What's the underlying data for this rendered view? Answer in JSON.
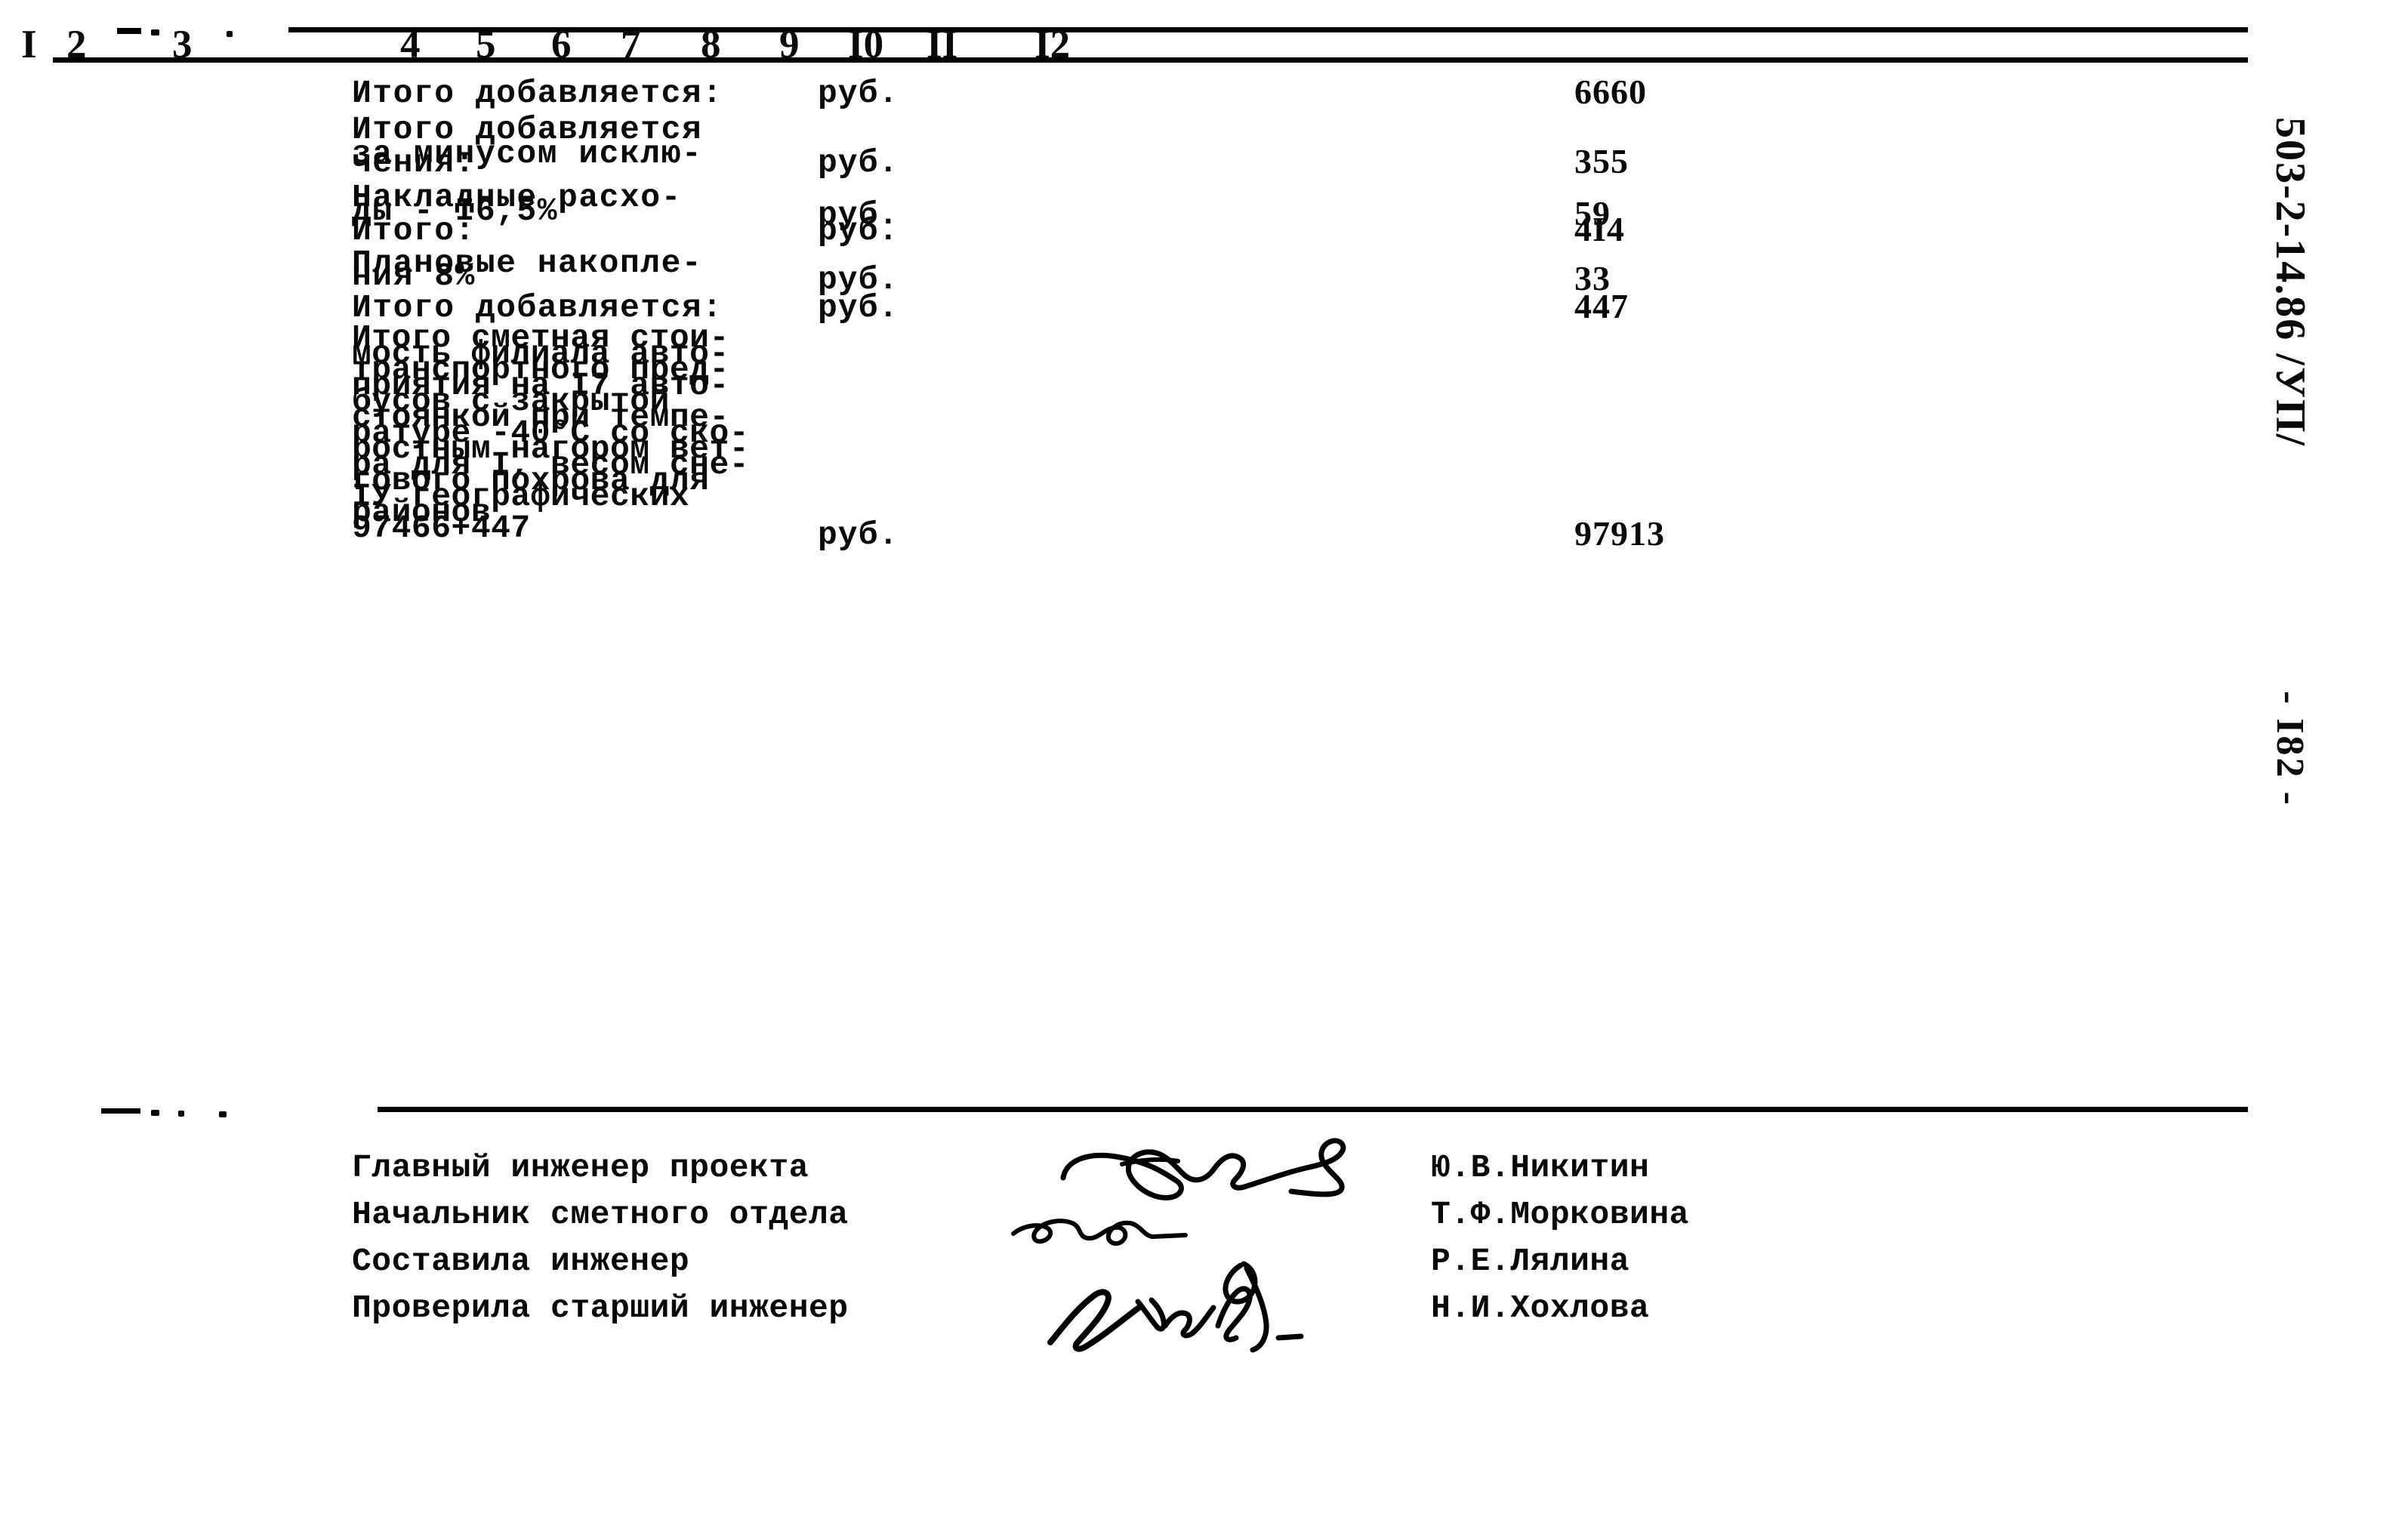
{
  "document": {
    "code": "503-2-14.86 /УП/",
    "page_marker": "- I82 -"
  },
  "table": {
    "column_headers": [
      "I",
      "2",
      "3",
      "4",
      "5",
      "6",
      "7",
      "8",
      "9",
      "I0",
      "II",
      "I2"
    ],
    "rows": [
      {
        "name": "Итого добавляется:",
        "unit": "руб.",
        "value": "6660"
      },
      {
        "name_lines": [
          "Итого добавляется",
          "за минусом исклю-",
          "чения:"
        ],
        "unit": "руб.",
        "value": "355"
      },
      {
        "name_lines": [
          "Накладные расхо-",
          "ды - I6,5%"
        ],
        "unit": "руб.",
        "value": "59"
      },
      {
        "name": "Итого:",
        "unit": "руб.",
        "value": "4I4"
      },
      {
        "name_lines": [
          "Плановые накопле-",
          "ния 8%"
        ],
        "unit": "руб.",
        "value": "33"
      },
      {
        "name": "Итого добавляется:",
        "unit": "руб.",
        "value": "447"
      },
      {
        "name_lines": [
          "Итого сметная стои-",
          "мость филиала авто-",
          "транспортного пред-",
          "приятия на I7 авто-",
          "бусов с закрытой",
          "стоянкой при темпе-",
          "ратуре -40°С со ско-",
          "ростным нагором вет-",
          "ра для I, весом сне-",
          "гового похрова для",
          "IУ географических",
          "районов",
          "97466+447"
        ],
        "unit": "руб.",
        "value": "97913"
      }
    ]
  },
  "signatures": [
    {
      "role": "Главный инженер проекта",
      "name": "Ю.В.Никитин"
    },
    {
      "role": "Начальник сметного отдела",
      "name": "Т.Ф.Морковина"
    },
    {
      "role": "Составила инженер",
      "name": "Р.Е.Лялина"
    },
    {
      "role": "Проверила старший инженер",
      "name": "Н.И.Хохлова"
    }
  ]
}
